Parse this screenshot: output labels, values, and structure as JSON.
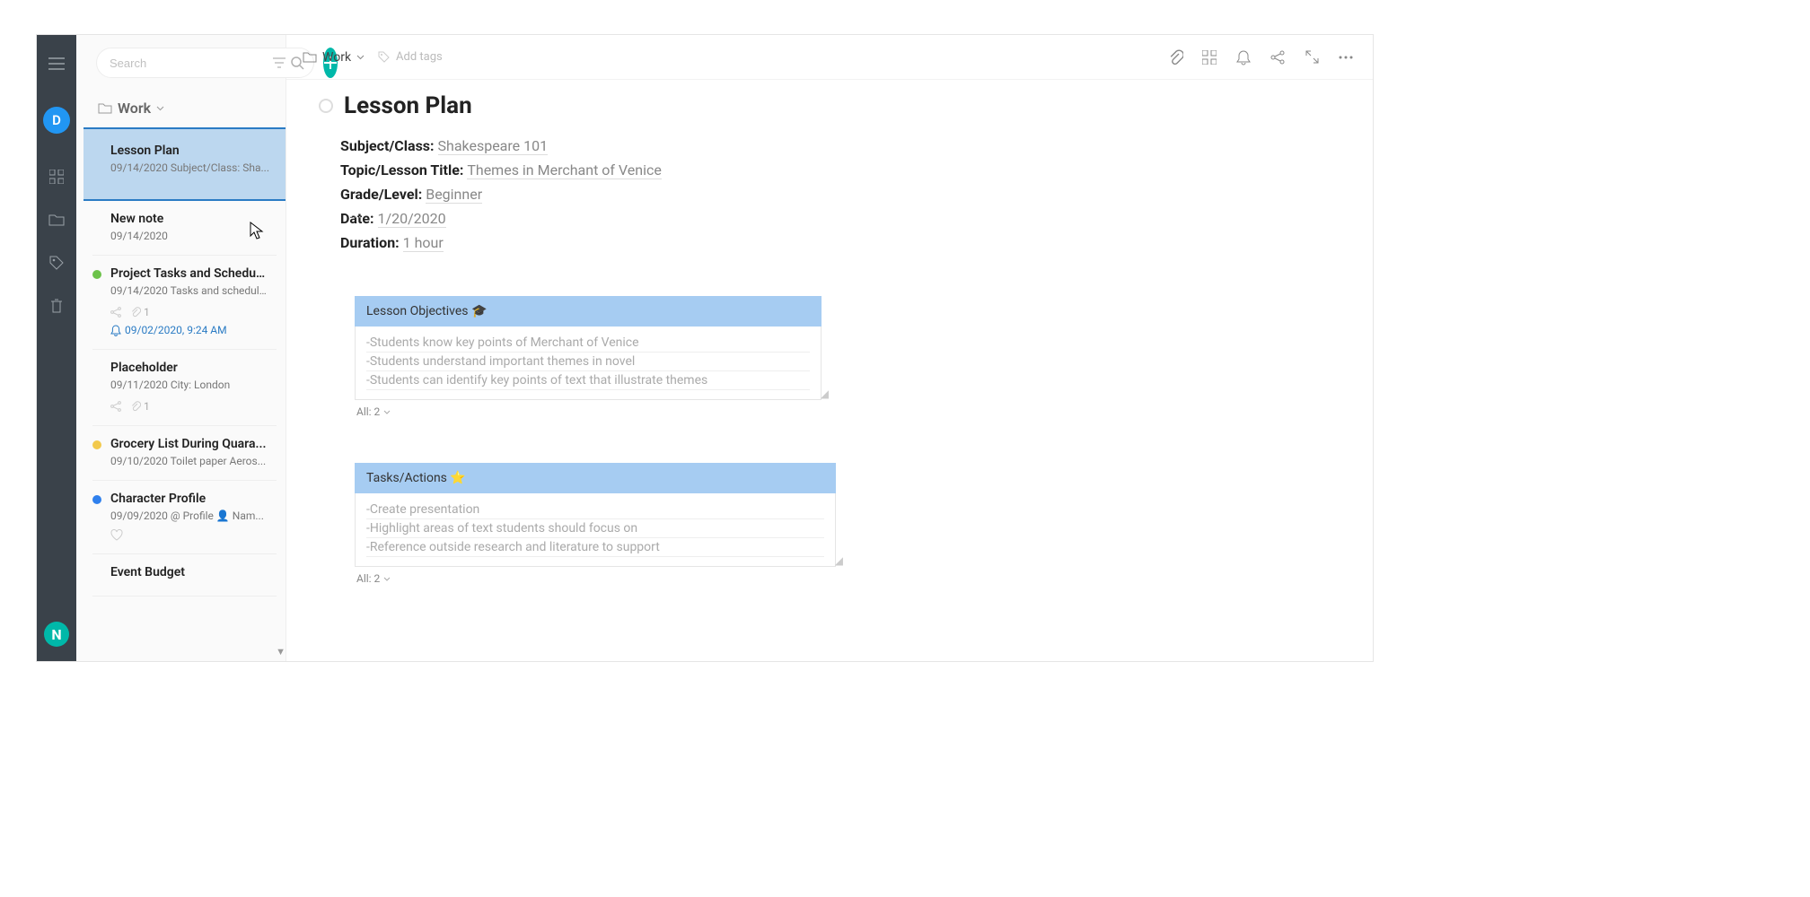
{
  "rail": {
    "avatar_letter": "D",
    "logo_letter": "N"
  },
  "sidebar": {
    "search_placeholder": "Search",
    "header": "Work",
    "notes": [
      {
        "title": "Lesson Plan",
        "snippet": "09/14/2020 Subject/Class: Sha...",
        "selected": true
      },
      {
        "title": "New note",
        "snippet": "09/14/2020"
      },
      {
        "title": "Project Tasks and Schedules",
        "snippet": "09/14/2020 Tasks and schedul...",
        "dot": "#6cc24a",
        "attach_count": "1",
        "reminder": "09/02/2020, 9:24 AM"
      },
      {
        "title": "Placeholder",
        "snippet": "09/11/2020 City: London",
        "attach_count": "1"
      },
      {
        "title": "Grocery List During Quara...",
        "snippet": "09/10/2020 Toilet paper Aeros...",
        "dot": "#f2c94c"
      },
      {
        "title": "Character Profile",
        "snippet": "09/09/2020 @ Profile 👤 Nam...",
        "dot": "#2f80ed",
        "heart": true
      },
      {
        "title": "Event Budget",
        "snippet": ""
      }
    ]
  },
  "topbar": {
    "breadcrumb": "Work",
    "add_tags": "Add tags"
  },
  "doc": {
    "title": "Lesson Plan",
    "fields": [
      {
        "label": "Subject/Class:",
        "value": "Shakespeare 101"
      },
      {
        "label": "Topic/Lesson Title:",
        "value": "Themes in Merchant of Venice"
      },
      {
        "label": "Grade/Level:",
        "value": "Beginner"
      },
      {
        "label": "Date:",
        "value": "1/20/2020",
        "handle": true
      },
      {
        "label": "Duration:",
        "value": "1 hour"
      }
    ],
    "blocks": [
      {
        "title": "Lesson Objectives 🎓",
        "lines": [
          "-Students know key points of Merchant of Venice",
          "-Students understand important themes in novel",
          "-Students can identify key points of text that illustrate themes"
        ],
        "footer": "All: 2"
      },
      {
        "title": "Tasks/Actions ⭐",
        "lines": [
          "-Create presentation",
          "-Highlight areas of text students should focus on",
          "-Reference outside research and literature to support"
        ],
        "footer": "All: 2",
        "wider": true
      }
    ]
  }
}
